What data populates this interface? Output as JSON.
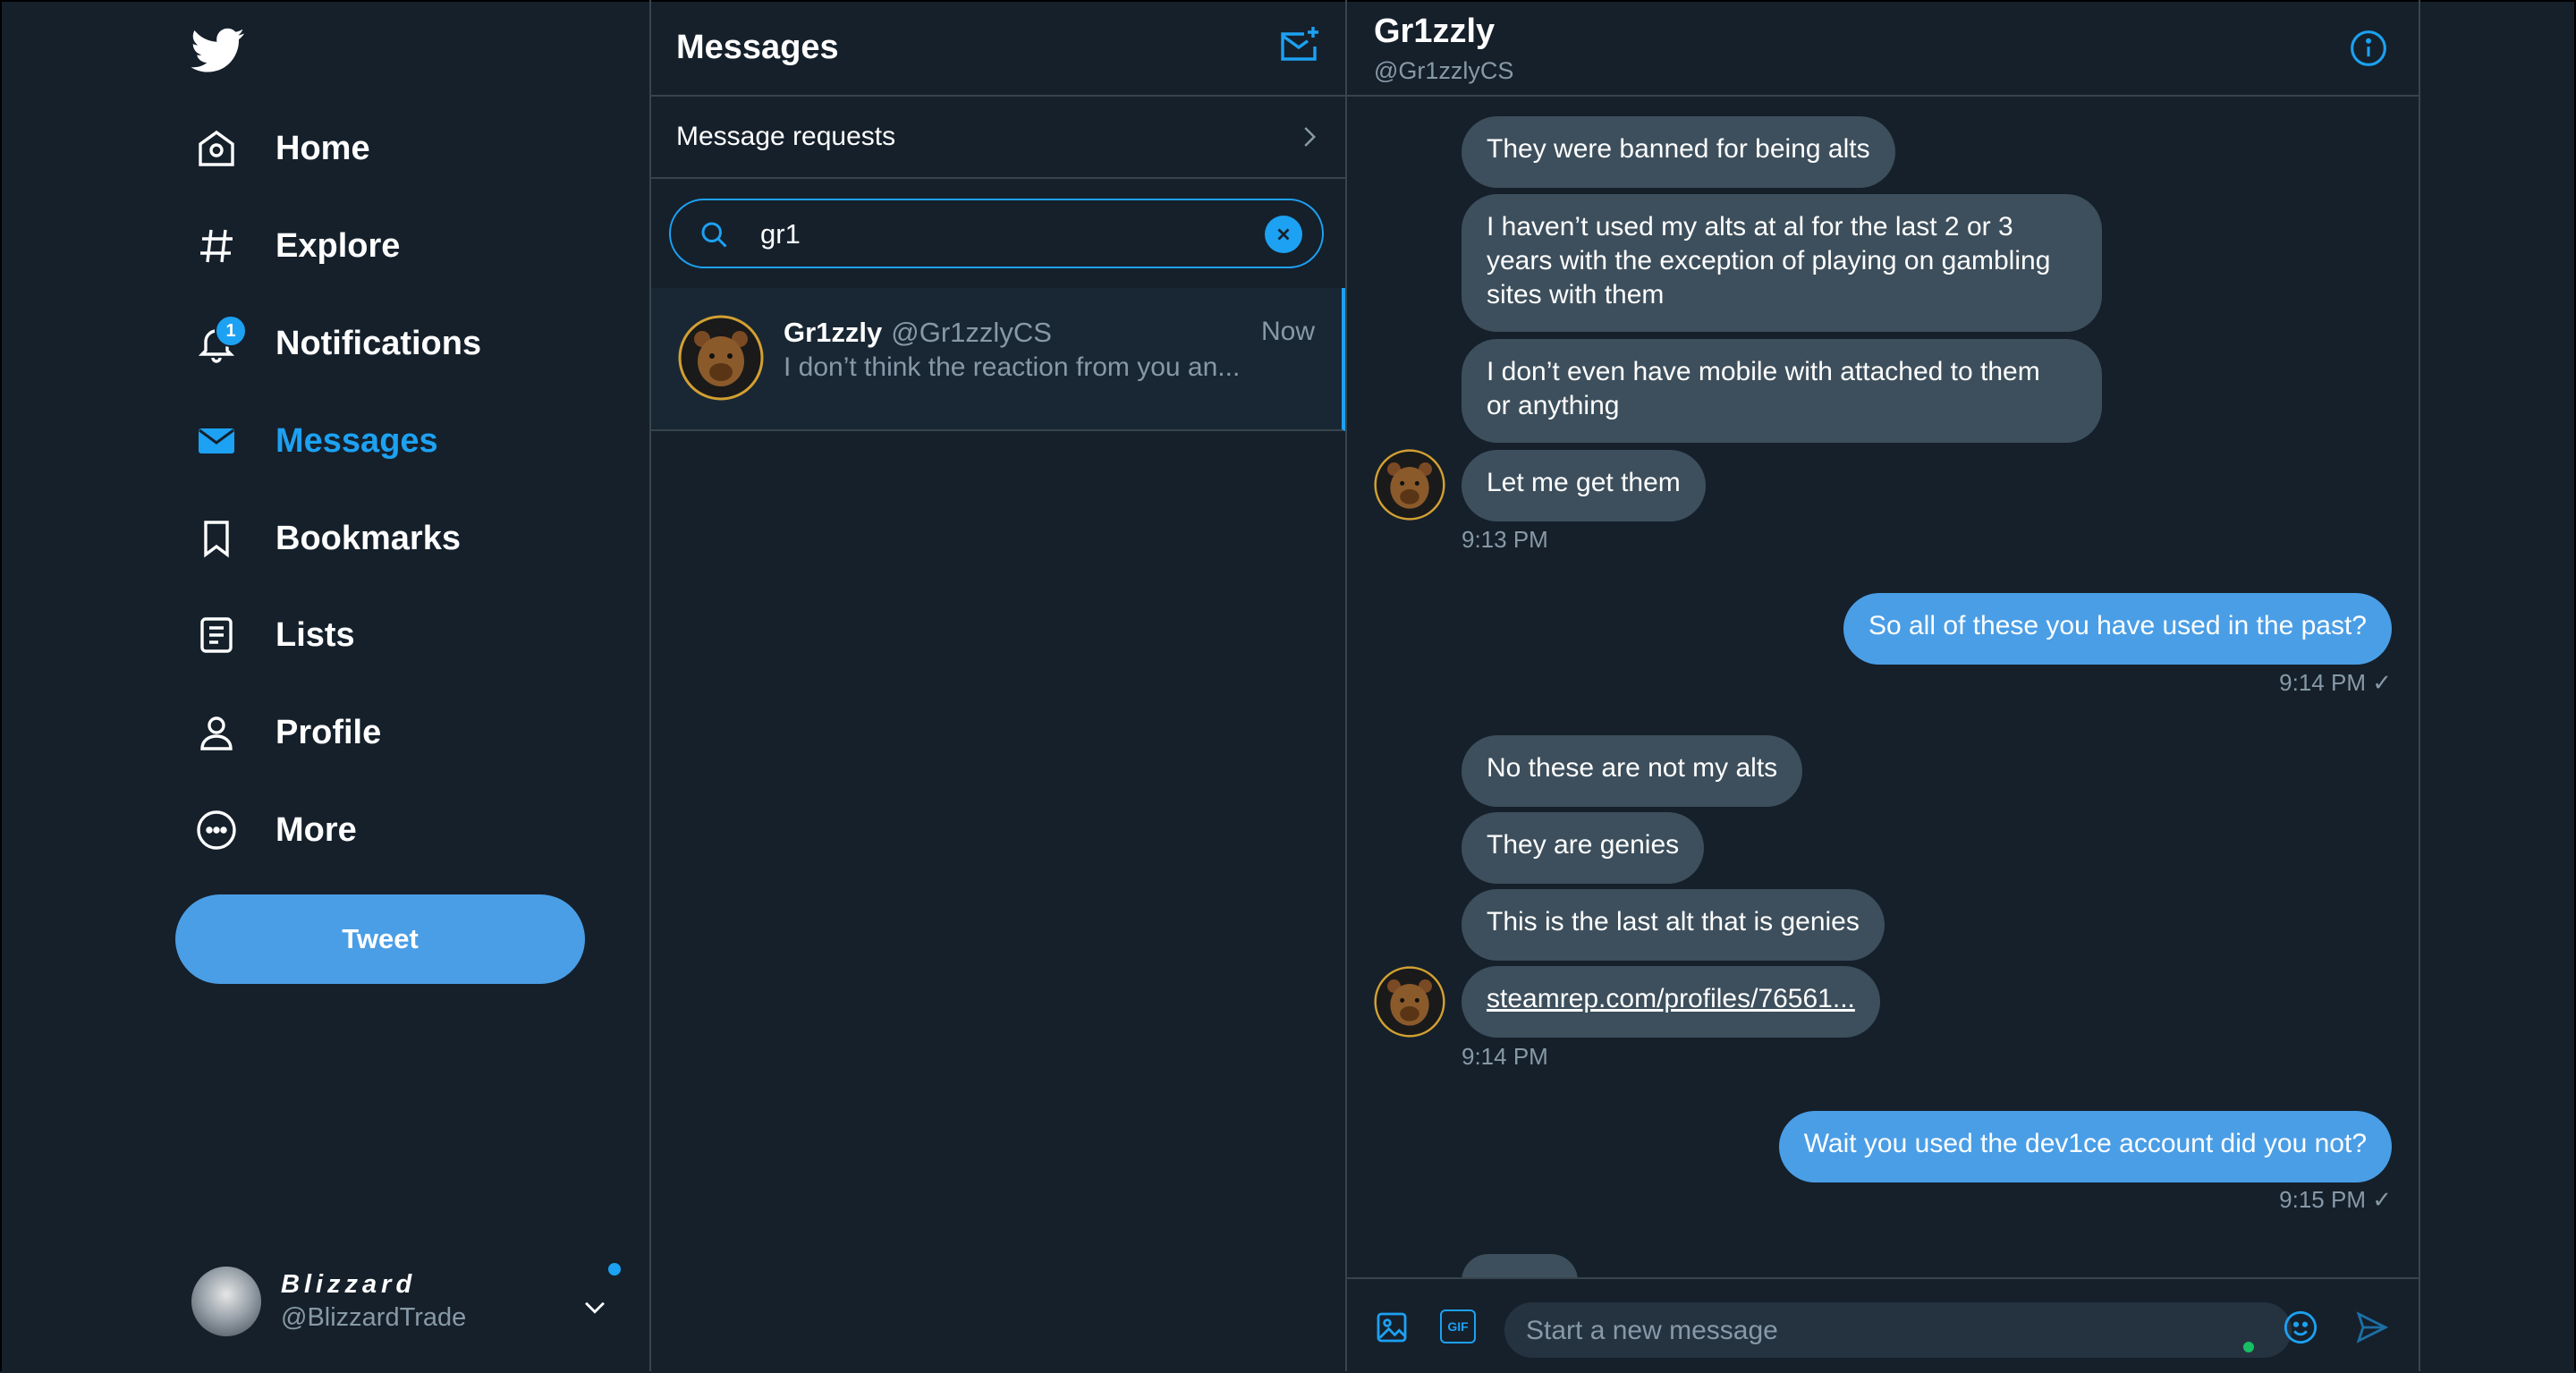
{
  "nav": {
    "items": [
      {
        "label": "Home",
        "icon": "home-icon"
      },
      {
        "label": "Explore",
        "icon": "hashtag-icon"
      },
      {
        "label": "Notifications",
        "icon": "bell-icon",
        "badge": "1"
      },
      {
        "label": "Messages",
        "icon": "envelope-icon",
        "active": true
      },
      {
        "label": "Bookmarks",
        "icon": "bookmark-icon"
      },
      {
        "label": "Lists",
        "icon": "list-icon"
      },
      {
        "label": "Profile",
        "icon": "person-icon"
      },
      {
        "label": "More",
        "icon": "more-icon"
      }
    ],
    "tweet_label": "Tweet",
    "account": {
      "name": "Blizzard",
      "handle": "@BlizzardTrade"
    }
  },
  "messages": {
    "title": "Messages",
    "requests_label": "Message requests",
    "search_value": "gr1",
    "conversation": {
      "name": "Gr1zzly",
      "handle": "@Gr1zzlyCS",
      "time": "Now",
      "snippet": "I don’t think the reaction from you an..."
    }
  },
  "chat": {
    "name": "Gr1zzly",
    "handle": "@Gr1zzlyCS",
    "messages": [
      "They were banned for being alts",
      "I haven’t used my alts at al for the last 2 or 3",
      "years with the exception of playing on gambling",
      "sites with them",
      "I don’t even have mobile with attached to them",
      "or anything",
      "Let me get them",
      "So all of these you have used in the past?",
      "No these are not my alts",
      "They are genies",
      "This is the last alt that is genies",
      "steamrep.com/profiles/76561...",
      "Wait you used the dev1ce account did you not?"
    ],
    "timestamps": [
      "9:13 PM",
      "9:14 PM ✓",
      "9:14 PM",
      "9:15 PM ✓"
    ],
    "composer_placeholder": "Start a new message",
    "gif_label": "GIF"
  },
  "colors": {
    "background": "#15202b",
    "accent": "#1da1f2",
    "bubble_in": "#3d4f5c",
    "bubble_out": "#4a9ee6",
    "muted": "#8899a6",
    "border": "#38444d"
  }
}
